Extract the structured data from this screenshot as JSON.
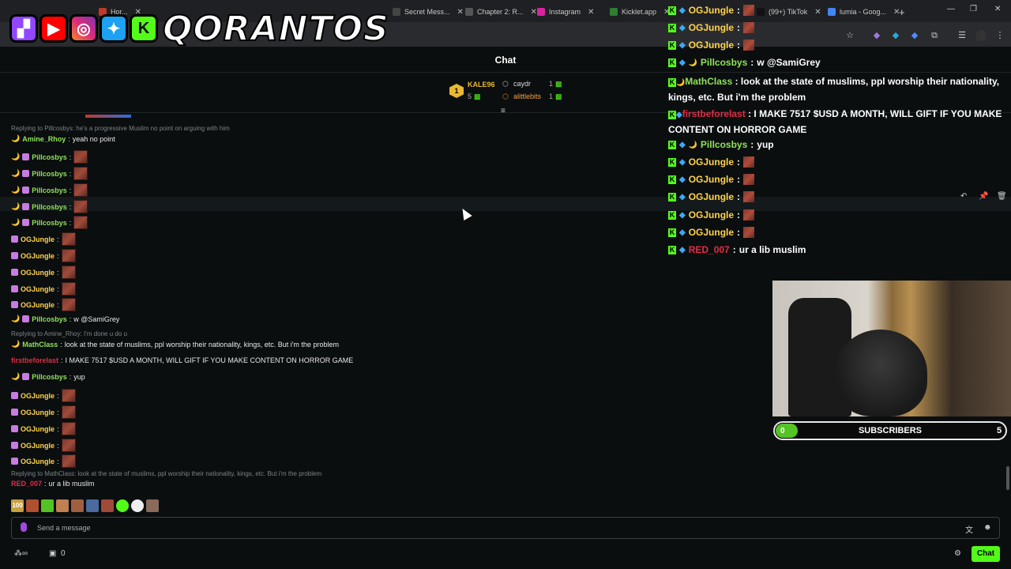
{
  "browser": {
    "tabs": [
      {
        "label": "Hor...",
        "color": "#c0392b"
      },
      {
        "label": "Secret Mess...",
        "color": "#444"
      },
      {
        "label": "Chapter 2: R...",
        "color": "#555"
      },
      {
        "label": "Instagram",
        "color": "#d6249f"
      },
      {
        "label": "Kicklet.app",
        "color": "#2e7d32"
      },
      {
        "label": "(99+) TikTok",
        "color": "#111"
      },
      {
        "label": "lumia - Goog...",
        "color": "#4285f4"
      }
    ],
    "new_tab": "+"
  },
  "logo": {
    "text": "QORANTOS",
    "icons": [
      "twitch-icon",
      "youtube-icon",
      "instagram-icon",
      "twitter-icon",
      "kick-icon"
    ]
  },
  "chat": {
    "title": "Chat",
    "gifters": {
      "first": {
        "name": "KALE96",
        "count": "5"
      },
      "second": {
        "name": "caydr",
        "count": "1"
      },
      "third": {
        "name": "alittlebits",
        "count": "1"
      }
    },
    "messages": [
      {
        "type": "reply",
        "text": "Replying to Pillcosbys: he's a progressive Muslim no point on arguing with him"
      },
      {
        "type": "msg",
        "user": "Amine_Rhoy",
        "color": "green",
        "text": "yeah no point",
        "emote": false
      },
      {
        "type": "msg",
        "user": "Pillcosbys",
        "color": "green",
        "text": "",
        "emote": true
      },
      {
        "type": "msg",
        "user": "Pillcosbys",
        "color": "green",
        "text": "",
        "emote": true
      },
      {
        "type": "msg",
        "user": "Pillcosbys",
        "color": "green",
        "text": "",
        "emote": true
      },
      {
        "type": "msg",
        "user": "Pillcosbys",
        "color": "green",
        "text": "",
        "emote": true
      },
      {
        "type": "msg",
        "user": "Pillcosbys",
        "color": "green",
        "text": "",
        "emote": true
      },
      {
        "type": "msg",
        "user": "OGJungle",
        "color": "yellow",
        "text": "",
        "emote": true
      },
      {
        "type": "msg",
        "user": "OGJungle",
        "color": "yellow",
        "text": "",
        "emote": true
      },
      {
        "type": "msg",
        "user": "OGJungle",
        "color": "yellow",
        "text": "",
        "emote": true
      },
      {
        "type": "msg",
        "user": "OGJungle",
        "color": "yellow",
        "text": "",
        "emote": true
      },
      {
        "type": "msg",
        "user": "OGJungle",
        "color": "yellow",
        "text": "",
        "emote": true
      },
      {
        "type": "msg",
        "user": "Pillcosbys",
        "color": "green",
        "text": "w @SamiGrey",
        "emote": false
      },
      {
        "type": "reply",
        "text": "Replying to Amine_Rhoy: I'm done u do u"
      },
      {
        "type": "msg",
        "user": "MathClass",
        "color": "green",
        "text": "look at the state of muslims, ppl worship their nationality, kings, etc. But i'm the problem",
        "emote": false
      },
      {
        "type": "msg",
        "user": "firstbeforelast",
        "color": "red",
        "text": "I MAKE 7517 $USD A MONTH, WILL GIFT IF YOU MAKE CONTENT ON HORROR GAME",
        "emote": false
      },
      {
        "type": "msg",
        "user": "Pillcosbys",
        "color": "green",
        "text": "yup",
        "emote": false
      },
      {
        "type": "msg",
        "user": "OGJungle",
        "color": "yellow",
        "text": "",
        "emote": true
      },
      {
        "type": "msg",
        "user": "OGJungle",
        "color": "yellow",
        "text": "",
        "emote": true
      },
      {
        "type": "msg",
        "user": "OGJungle",
        "color": "yellow",
        "text": "",
        "emote": true
      },
      {
        "type": "msg",
        "user": "OGJungle",
        "color": "yellow",
        "text": "",
        "emote": true
      },
      {
        "type": "msg",
        "user": "OGJungle",
        "color": "yellow",
        "text": "",
        "emote": true
      },
      {
        "type": "reply",
        "text": "Replying to MathClass: look at the state of muslims, ppl worship their nationality, kings, etc. But i'm the problem"
      },
      {
        "type": "msg",
        "user": "RED_007",
        "color": "red",
        "text": "ur a lib muslim",
        "emote": false
      }
    ],
    "input_placeholder": "Send a message",
    "chat_button": "Chat",
    "bottom_count": "0"
  },
  "overlay": {
    "messages": [
      {
        "user": "OGJungle",
        "color": "yellow",
        "text": "",
        "emote": true
      },
      {
        "user": "OGJungle",
        "color": "yellow",
        "text": "",
        "emote": true
      },
      {
        "user": "OGJungle",
        "color": "yellow",
        "text": "",
        "emote": true
      },
      {
        "user": "Pillcosbys",
        "color": "green",
        "text": "w @SamiGrey",
        "emote": false
      },
      {
        "user": "MathClass",
        "color": "green",
        "text": "look at the state of muslims, ppl worship their nationality, kings, etc. But i'm the problem",
        "emote": false
      },
      {
        "user": "firstbeforelast",
        "color": "red",
        "text": "I MAKE 7517 $USD A MONTH, WILL GIFT IF YOU MAKE CONTENT ON HORROR GAME",
        "emote": false
      },
      {
        "user": "Pillcosbys",
        "color": "green",
        "text": "yup",
        "emote": false
      },
      {
        "user": "OGJungle",
        "color": "yellow",
        "text": "",
        "emote": true
      },
      {
        "user": "OGJungle",
        "color": "yellow",
        "text": "",
        "emote": true
      },
      {
        "user": "OGJungle",
        "color": "yellow",
        "text": "",
        "emote": true
      },
      {
        "user": "OGJungle",
        "color": "yellow",
        "text": "",
        "emote": true
      },
      {
        "user": "OGJungle",
        "color": "yellow",
        "text": "",
        "emote": true
      },
      {
        "user": "RED_007",
        "color": "red",
        "text": "ur a lib muslim",
        "emote": false
      }
    ],
    "subscribers": {
      "current": "0",
      "label": "SUBSCRIBERS",
      "goal": "5",
      "progress": 0.0
    }
  }
}
